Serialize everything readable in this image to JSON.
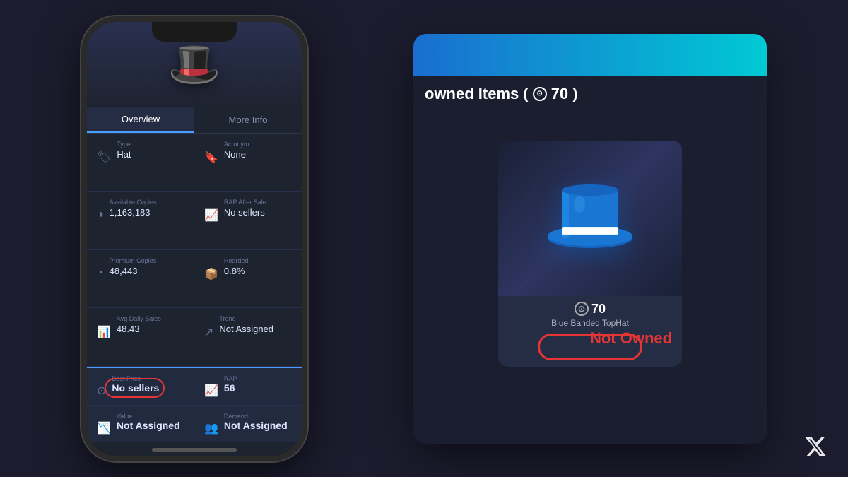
{
  "background": "#1c1c2e",
  "phone": {
    "tabs": [
      {
        "label": "Overview",
        "active": true
      },
      {
        "label": "More Info",
        "active": false
      }
    ],
    "info_cells": [
      {
        "label": "Type",
        "value": "Hat",
        "icon": "🏷"
      },
      {
        "label": "Acronym",
        "value": "None",
        "icon": "🔖"
      },
      {
        "label": "Available Copies",
        "value": "1,163,183",
        "icon": "⏰"
      },
      {
        "label": "RAP After Sale",
        "value": "No sellers",
        "icon": "📈"
      },
      {
        "label": "Premium Copies",
        "value": "48,443",
        "icon": "⏱"
      },
      {
        "label": "Hoarded",
        "value": "0.8%",
        "icon": "📦"
      },
      {
        "label": "Avg Daily Sales",
        "value": "48.43",
        "icon": "📊"
      },
      {
        "label": "Trend",
        "value": "Not Assigned",
        "icon": "↗"
      }
    ],
    "best_price": {
      "label": "Best Price",
      "value": "No sellers",
      "highlighted": true
    },
    "rap": {
      "label": "RAP",
      "value": "56"
    },
    "value": {
      "label": "Value",
      "value": "Not Assigned"
    },
    "demand": {
      "label": "Demand",
      "value": "Not Assigned"
    }
  },
  "game_panel": {
    "title": "owned Items (⊙70)",
    "title_prefix": "owned Items (",
    "robux_amount": "70",
    "title_suffix": ")",
    "item": {
      "price": "70",
      "name": "Blue Banded TopHat",
      "status": "Not Owned"
    }
  },
  "annotations": {
    "circle_sellers": true,
    "circle_not_owned": true
  }
}
